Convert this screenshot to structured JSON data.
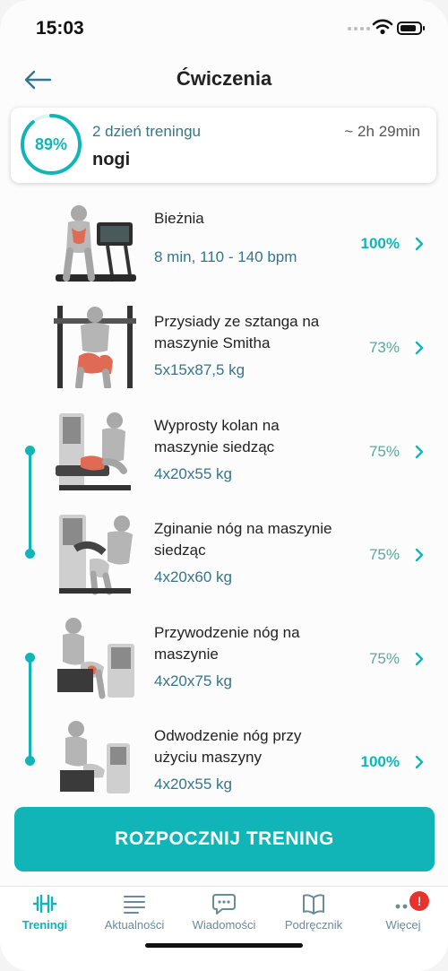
{
  "status": {
    "time": "15:03"
  },
  "header": {
    "title": "Ćwiczenia",
    "back_icon": "arrow-left-icon"
  },
  "summary": {
    "progress_percent": 89,
    "progress_label": "89%",
    "day_label": "2 dzień treningu",
    "duration": "~ 2h 29min",
    "workout_name": "nogi"
  },
  "exercises": [
    {
      "name": "Bieżnia",
      "detail": "8 min, 110 - 140 bpm",
      "percent": "100%"
    },
    {
      "name": "Przysiady ze sztanga na maszynie Smitha",
      "detail": "5x15x87,5 kg",
      "percent": "73%"
    },
    {
      "name": "Wyprosty kolan na maszynie siedząc",
      "detail": "4x20x55 kg",
      "percent": "75%"
    },
    {
      "name": "Zginanie nóg na maszynie siedząc",
      "detail": "4x20x60 kg",
      "percent": "75%"
    },
    {
      "name": "Przywodzenie nóg na maszynie",
      "detail": "4x20x75 kg",
      "percent": "75%"
    },
    {
      "name": "Odwodzenie nóg przy użyciu maszyny",
      "detail": "4x20x55 kg",
      "percent": "100%"
    }
  ],
  "start_button": {
    "label": "ROZPOCZNIJ TRENING"
  },
  "tabs": [
    {
      "label": "Treningi",
      "icon": "dumbbell-icon"
    },
    {
      "label": "Aktualności",
      "icon": "news-lines-icon"
    },
    {
      "label": "Wiadomości",
      "icon": "chat-bubble-icon"
    },
    {
      "label": "Podręcznik",
      "icon": "book-icon"
    },
    {
      "label": "Więcej",
      "icon": "more-dots-icon",
      "badge": "!"
    }
  ],
  "colors": {
    "accent": "#12b5b7",
    "detail_text": "#35758a",
    "badge": "#e8322e"
  }
}
